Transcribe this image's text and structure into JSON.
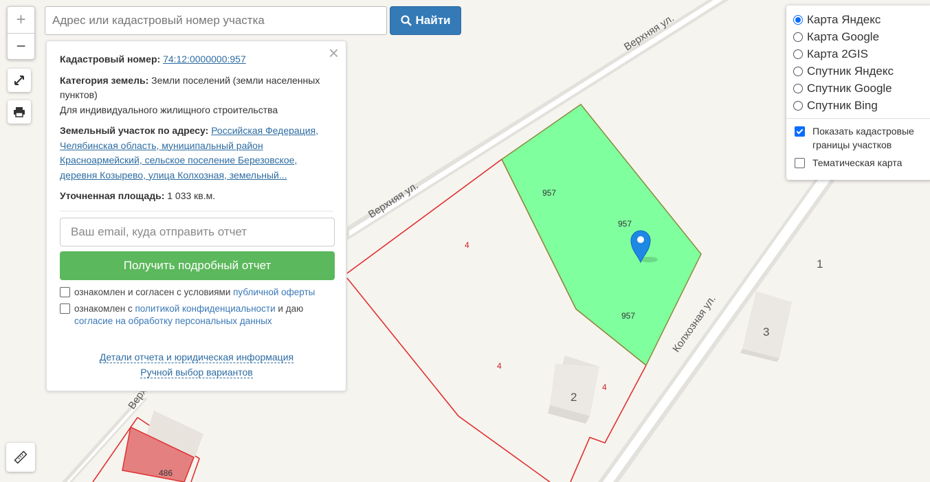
{
  "zoom": {
    "in_label": "+",
    "out_label": "−"
  },
  "search": {
    "placeholder": "Адрес или кадастровый номер участка",
    "button_label": "Найти"
  },
  "info": {
    "cadastral_label": "Кадастровый номер:",
    "cadastral_number": "74:12:0000000:957",
    "category_label": "Категория земель:",
    "category_value": "Земли поселений (земли населенных пунктов)",
    "permitted_use": "Для индивидуального жилищного строительства",
    "address_label": "Земельный участок по адресу:",
    "address_value": "Российская Федерация, Челябинская область, муниципальный район Красноармейский, сельское поселение Березовское, деревня Козырево, улица Колхозная, земельный...",
    "area_label": "Уточненная площадь:",
    "area_value": "1 033 кв.м.",
    "close_label": "×",
    "email_placeholder": "Ваш email, куда отправить отчет",
    "report_button": "Получить подробный отчет",
    "offer_text": "ознакомлен и согласен с условиями",
    "offer_link": "публичной оферты",
    "privacy_text": "ознакомлен с",
    "privacy_link": "политикой конфиденциальности",
    "privacy_text2": "и даю",
    "consent_link": "согласие на обработку персональных данных",
    "details_link": "Детали отчета и юридическая информация",
    "manual_link": "Ручной выбор вариантов"
  },
  "layers": {
    "base_maps": [
      {
        "label": "Карта Яндекс",
        "selected": true
      },
      {
        "label": "Карта Google",
        "selected": false
      },
      {
        "label": "Карта 2GIS",
        "selected": false
      },
      {
        "label": "Спутник Яндекс",
        "selected": false
      },
      {
        "label": "Спутник Google",
        "selected": false
      },
      {
        "label": "Спутник Bing",
        "selected": false
      }
    ],
    "overlays": [
      {
        "label": "Показать кадастровые границы участков",
        "checked": true
      },
      {
        "label": "Тематическая карта",
        "checked": false
      }
    ]
  },
  "map": {
    "streets": {
      "verkhnyaya_1": "Верхняя ул.",
      "verkhnyaya_2": "Верхняя ул.",
      "verkhnyaya_3": "Верх",
      "kolkhoznaya": "Колхозная ул."
    },
    "plot_labels": {
      "p957_a": "957",
      "p957_b": "957",
      "p957_c": "957",
      "p4_a": "4",
      "p4_b": "4",
      "p4_c": "4",
      "p486": "486"
    },
    "buildings": {
      "b1": "1",
      "b2": "2",
      "b3": "3"
    },
    "colors": {
      "selected_plot": "#80ff9f",
      "boundary": "#e03030",
      "parcel_486": "#e58080",
      "road": "#ffffff",
      "marker": "#1e88e5"
    }
  }
}
